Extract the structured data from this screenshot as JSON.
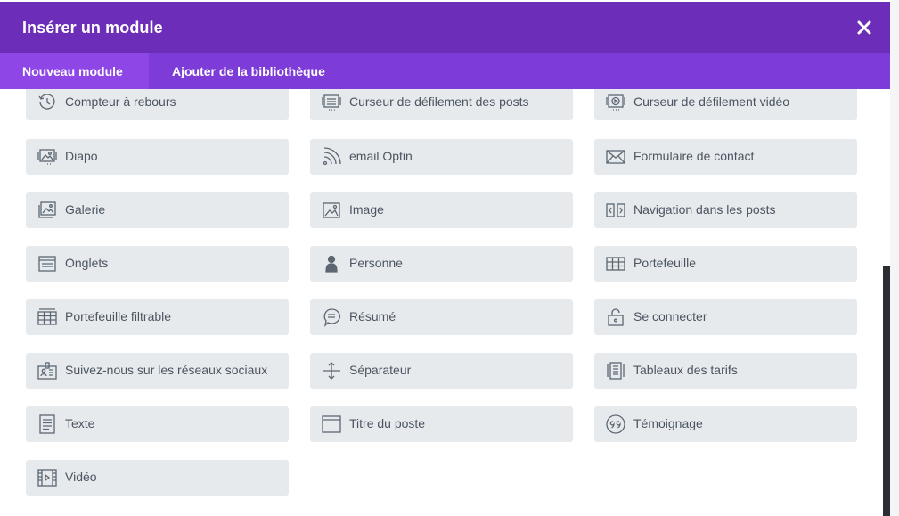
{
  "modal": {
    "title": "Insérer un module",
    "close_icon": "close-icon",
    "colors": {
      "header": "#6c2eb9",
      "tabs": "#7d3bd8",
      "active_tab": "#8e46e6",
      "tile": "#e7eaed",
      "text": "#4b5561"
    }
  },
  "tabs": [
    {
      "label": "Nouveau module",
      "active": true
    },
    {
      "label": "Ajouter de la bibliothèque",
      "active": false
    }
  ],
  "modules": [
    {
      "label": "Compteur à rebours",
      "icon": "clock-icon"
    },
    {
      "label": "Curseur de défilement des posts",
      "icon": "post-slider-icon"
    },
    {
      "label": "Curseur de défilement vidéo",
      "icon": "video-slider-icon"
    },
    {
      "label": "Diapo",
      "icon": "slider-icon"
    },
    {
      "label": "email Optin",
      "icon": "rss-icon"
    },
    {
      "label": "Formulaire de contact",
      "icon": "envelope-icon"
    },
    {
      "label": "Galerie",
      "icon": "gallery-icon"
    },
    {
      "label": "Image",
      "icon": "image-icon"
    },
    {
      "label": "Navigation dans les posts",
      "icon": "post-navigation-icon"
    },
    {
      "label": "Onglets",
      "icon": "tabs-icon"
    },
    {
      "label": "Personne",
      "icon": "person-icon"
    },
    {
      "label": "Portefeuille",
      "icon": "grid-icon"
    },
    {
      "label": "Portefeuille filtrable",
      "icon": "filterable-grid-icon"
    },
    {
      "label": "Résumé",
      "icon": "speech-bubble-icon"
    },
    {
      "label": "Se connecter",
      "icon": "lock-icon"
    },
    {
      "label": "Suivez-nous sur les réseaux sociaux",
      "icon": "social-follow-icon"
    },
    {
      "label": "Séparateur",
      "icon": "divider-icon"
    },
    {
      "label": "Tableaux des tarifs",
      "icon": "pricing-table-icon"
    },
    {
      "label": "Texte",
      "icon": "text-document-icon"
    },
    {
      "label": "Titre du poste",
      "icon": "post-title-icon"
    },
    {
      "label": "Témoignage",
      "icon": "quote-icon"
    },
    {
      "label": "Vidéo",
      "icon": "video-icon"
    }
  ]
}
